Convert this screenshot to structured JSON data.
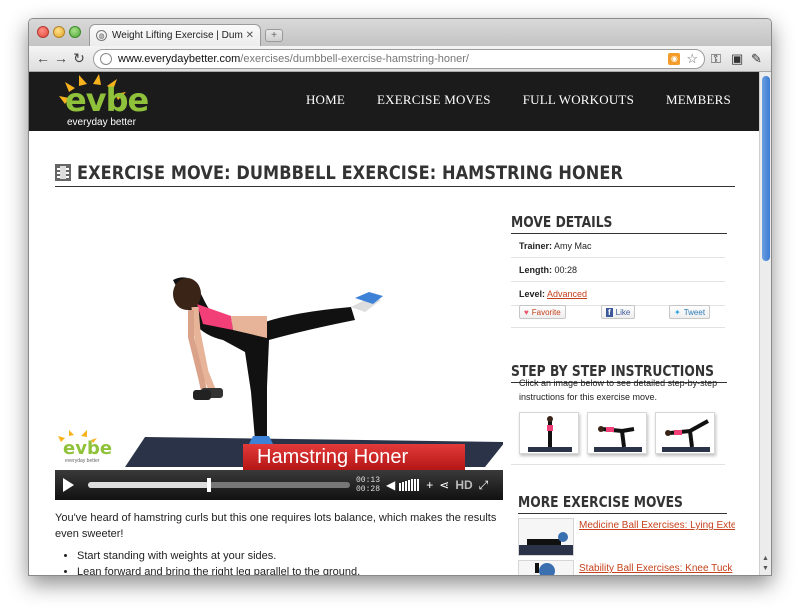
{
  "browser": {
    "tab_title": "Weight Lifting Exercise | Dum",
    "url_domain": "www.everydaybetter.com",
    "url_path": "/exercises/dumbbell-exercise-hamstring-honer/"
  },
  "site": {
    "logo_word": "evbe",
    "logo_tagline": "everyday better",
    "nav": [
      "HOME",
      "EXERCISE MOVES",
      "FULL WORKOUTS",
      "MEMBERS"
    ]
  },
  "page": {
    "title": "EXERCISE MOVE: DUMBBELL EXERCISE: HAMSTRING HONER"
  },
  "video": {
    "caption": "Hamstring Honer",
    "time_current": "00:13",
    "time_total": "00:28",
    "progress_fraction": 0.46,
    "hd_label": "HD",
    "watermark": "evbe",
    "watermark_tag": "everyday better"
  },
  "description": {
    "intro": "You've heard of hamstring curls but this one requires lots balance, which makes the results even sweeter!",
    "steps": [
      "Start standing with weights at your sides.",
      "Lean forward and bring the right leg parallel to the ground."
    ]
  },
  "sidebar": {
    "move_details_heading": "MOVE DETAILS",
    "trainer_label": "Trainer:",
    "trainer_value": "Amy Mac",
    "length_label": "Length:",
    "length_value": "00:28",
    "level_label": "Level:",
    "level_value": "Advanced",
    "favorite_label": "Favorite",
    "like_label": "Like",
    "tweet_label": "Tweet",
    "steps_heading": "STEP BY STEP INSTRUCTIONS",
    "steps_text": "Click an image below to see detailed step-by-step instructions for this exercise move.",
    "more_heading": "MORE EXERCISE MOVES",
    "more_links": [
      "Medicine Ball Exercises: Lying Exte",
      "Stability Ball Exercises: Knee Tuck"
    ]
  },
  "colors": {
    "accent_link": "#c5411b",
    "logo_green": "#8fc23a",
    "header_bg": "#1b1b1b",
    "caption_red": "#d42828"
  }
}
